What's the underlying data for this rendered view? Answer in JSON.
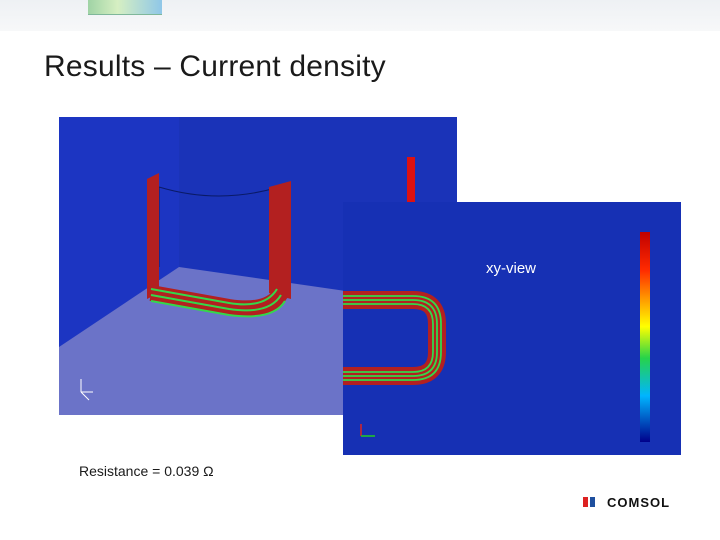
{
  "slide": {
    "title": "Results – Current density",
    "view_label": "xy-view",
    "resistance": "Resistance = 0.039 Ω",
    "brand": "COMSOL"
  },
  "colors": {
    "panel_background": "#1730b5",
    "floor": "#6b73c8",
    "conductor": "#b32020",
    "current_arrows": "#34d84a",
    "brand_red": "#d22",
    "brand_blue": "#1e4f9e"
  },
  "icons": {
    "axis": "axis-triad-icon",
    "colorbar": "colorbar-legend"
  }
}
